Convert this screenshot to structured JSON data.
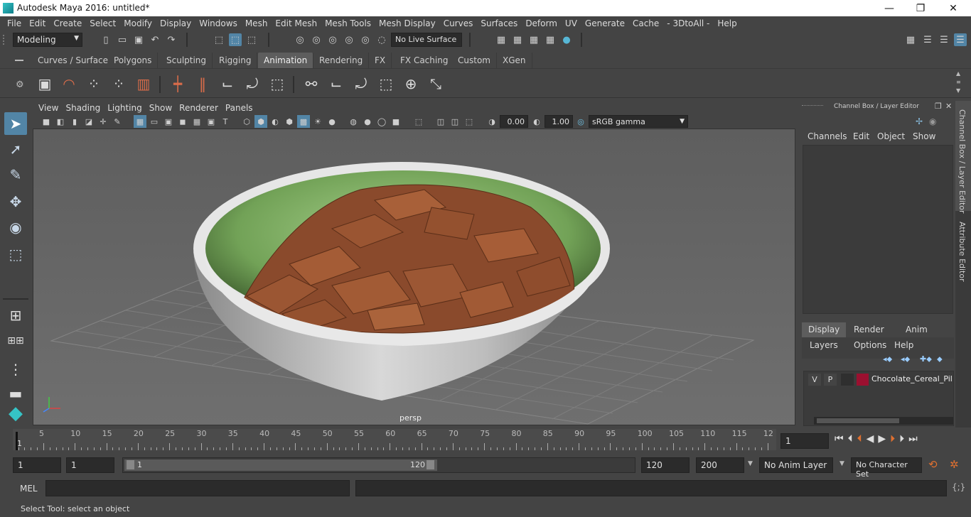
{
  "window": {
    "title": "Autodesk Maya 2016: untitled*",
    "minimize": "—",
    "maximize": "❐",
    "close": "✕"
  },
  "menu": [
    "File",
    "Edit",
    "Create",
    "Select",
    "Modify",
    "Display",
    "Windows",
    "Mesh",
    "Edit Mesh",
    "Mesh Tools",
    "Mesh Display",
    "Curves",
    "Surfaces",
    "Deform",
    "UV",
    "Generate",
    "Cache",
    "- 3DtoAll -",
    "Help"
  ],
  "status": {
    "mode": "Modeling",
    "live_surface": "No Live Surface"
  },
  "shelf_tabs": [
    "Curves / Surfaces",
    "Polygons",
    "Sculpting",
    "Rigging",
    "Animation",
    "Rendering",
    "FX",
    "FX Caching",
    "Custom",
    "XGen"
  ],
  "active_shelf_tab": "Animation",
  "panel_menu": [
    "View",
    "Shading",
    "Lighting",
    "Show",
    "Renderer",
    "Panels"
  ],
  "panel_toolbar": {
    "exposure": "0.00",
    "gamma": "1.00",
    "color_space": "sRGB gamma"
  },
  "viewport": {
    "camera_label": "persp"
  },
  "channel_box": {
    "header": "Channel Box / Layer Editor",
    "menu": [
      "Channels",
      "Edit",
      "Object",
      "Show"
    ],
    "tabs": [
      "Display",
      "Render",
      "Anim"
    ],
    "layer_menu": [
      "Layers",
      "Options",
      "Help"
    ],
    "layer": {
      "v": "V",
      "p": "P",
      "name": "Chocolate_Cereal_Pillo",
      "color": "#9b1030"
    }
  },
  "side_tabs": [
    "Channel Box / Layer Editor",
    "Attribute Editor"
  ],
  "timeline": {
    "ticks": [
      "5",
      "10",
      "15",
      "20",
      "25",
      "30",
      "35",
      "40",
      "45",
      "50",
      "55",
      "60",
      "65",
      "70",
      "75",
      "80",
      "85",
      "90",
      "95",
      "100",
      "105",
      "110",
      "115",
      "12"
    ],
    "start_marker": "1",
    "current_frame": "1"
  },
  "range": {
    "start": "1",
    "inner_start": "1",
    "slider_start": "1",
    "slider_end": "120",
    "end": "120",
    "max_end": "200",
    "anim_layer": "No Anim Layer",
    "character_set": "No Character Set"
  },
  "command": {
    "label": "MEL"
  },
  "help_line": "Select Tool: select an object"
}
